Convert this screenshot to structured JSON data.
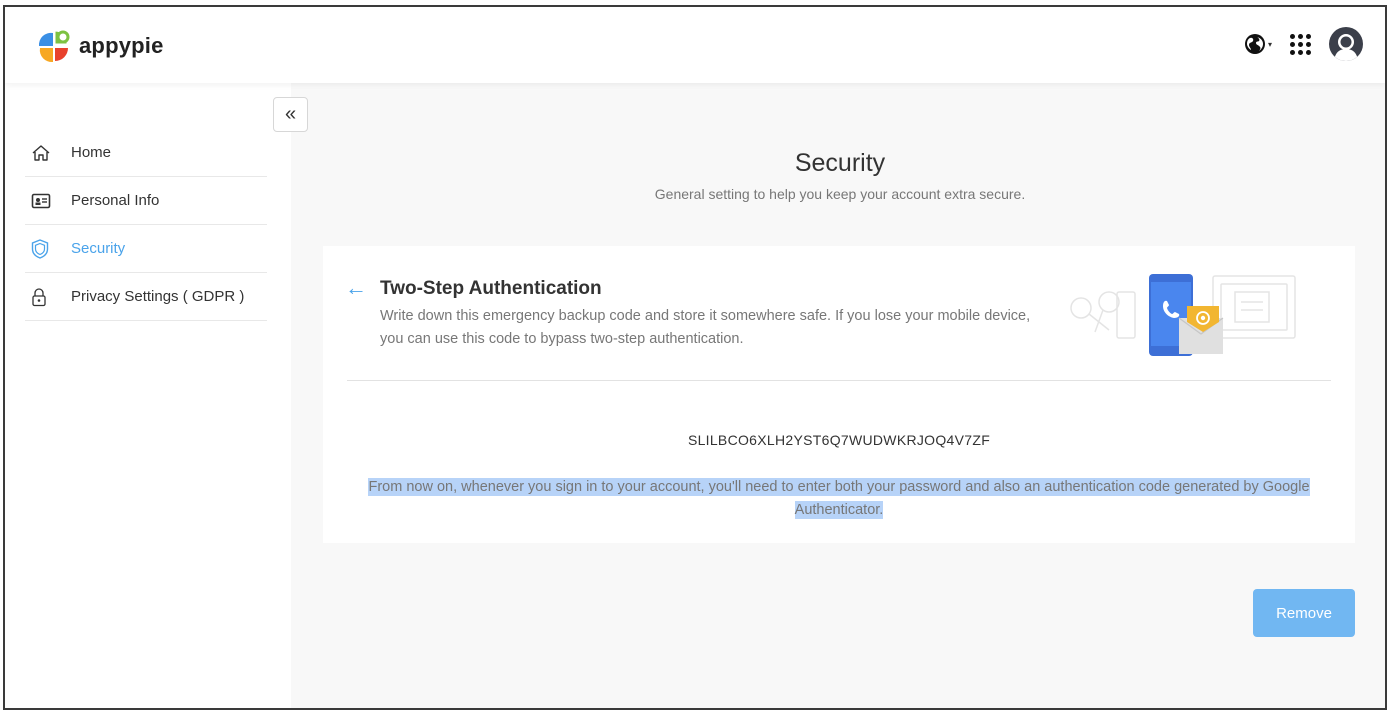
{
  "header": {
    "logo_text": "appypie",
    "icons": [
      "globe-icon",
      "apps-grid-icon",
      "user-avatar-icon"
    ]
  },
  "sidebar": {
    "collapse_icon": "double-chevron-left-icon",
    "collapse_glyph": "«",
    "items": [
      {
        "label": "Home",
        "icon": "home-icon",
        "active": false
      },
      {
        "label": "Personal Info",
        "icon": "id-card-icon",
        "active": false
      },
      {
        "label": "Security",
        "icon": "shield-icon",
        "active": true
      },
      {
        "label": "Privacy Settings ( GDPR )",
        "icon": "lock-icon",
        "active": false
      }
    ]
  },
  "main": {
    "title": "Security",
    "subtitle": "General setting to help you keep your account extra secure.",
    "card": {
      "back_icon": "arrow-left-icon",
      "back_glyph": "←",
      "title": "Two-Step Authentication",
      "description": "Write down this emergency backup code and store it somewhere safe. If you lose your mobile device, you can use this code to bypass two-step authentication.",
      "backup_code": "SLILBCO6XLH2YST6Q7WUDWKRJOQ4V7ZF",
      "note": "From now on, whenever you sign in to your account, you'll need to enter both your password and also an authentication code generated by Google Authenticator."
    },
    "remove_label": "Remove"
  },
  "colors": {
    "accent": "#4aa3ea",
    "button": "#71b7f2",
    "highlight": "#b7d3f8",
    "main_bg": "#f8f8f8"
  }
}
